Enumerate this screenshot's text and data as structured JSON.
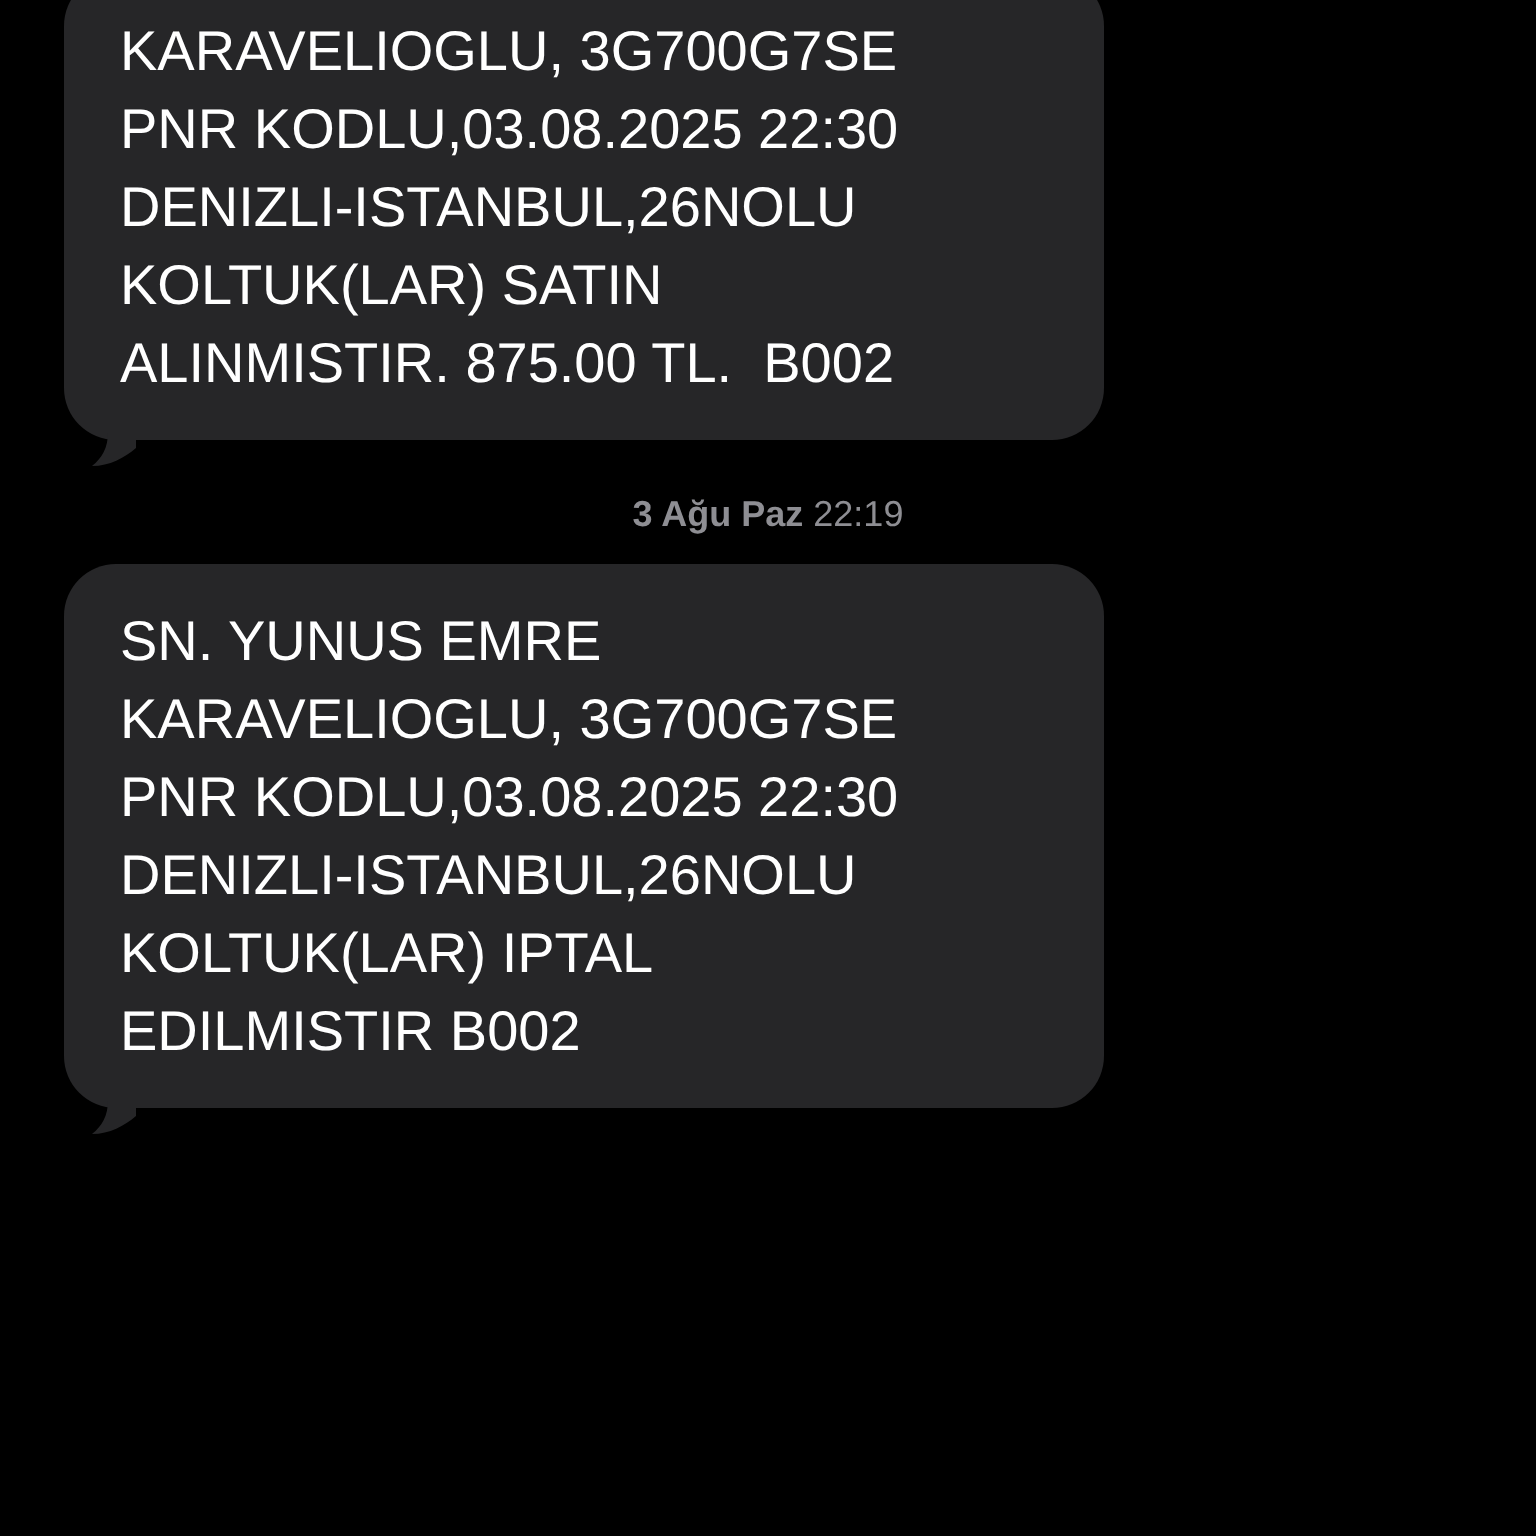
{
  "messages": [
    {
      "text": "KARAVELIOGLU, 3G700G7SE\nPNR KODLU,03.08.2025 22:30\nDENIZLI-ISTANBUL,26NOLU\nKOLTUK(LAR) SATIN\nALINMISTIR. 875.00 TL.  B002"
    },
    {
      "timestamp": "**3 Ağu Paz** 22:19",
      "text": "SN. YUNUS EMRE\nKARAVELIOGLU, 3G700G7SE\nPNR KODLU,03.08.2025 22:30\nDENIZLI-ISTANBUL,26NOLU\nKOLTUK(LAR) IPTAL\nEDILMISTIR B002"
    }
  ]
}
